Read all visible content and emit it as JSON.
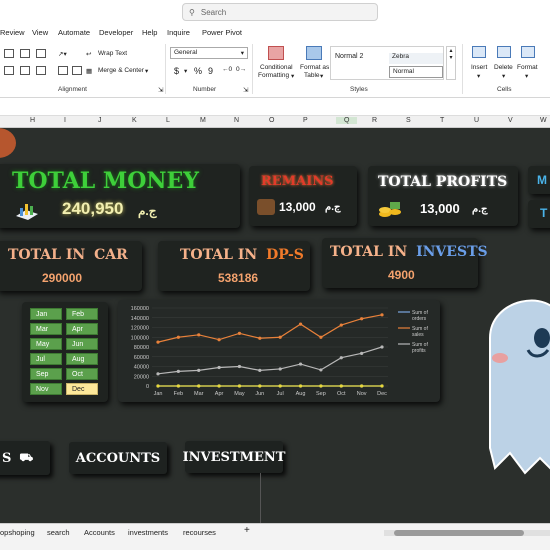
{
  "search": {
    "placeholder": "Search"
  },
  "ribbon_tabs": [
    "Review",
    "View",
    "Automate",
    "Developer",
    "Help",
    "Inquire",
    "Power Pivot"
  ],
  "ribbon": {
    "wrap_text": "Wrap Text",
    "merge_center": "Merge & Center",
    "alignment_label": "Alignment",
    "number_format": "General",
    "currency": "$",
    "percent": "%",
    "comma": "9",
    "number_label": "Number",
    "conditional": "Conditional",
    "formatting": "Formatting",
    "format_as": "Format as",
    "table": "Table",
    "style_normal2": "Normal 2",
    "style_zebra": "Zebra",
    "style_normal": "Normal",
    "styles_label": "Styles",
    "insert": "Insert",
    "delete": "Delete",
    "format": "Format",
    "cells_label": "Cells"
  },
  "columns": [
    "H",
    "I",
    "J",
    "K",
    "L",
    "M",
    "N",
    "O",
    "P",
    "Q",
    "R",
    "S",
    "T",
    "U",
    "V",
    "W"
  ],
  "dashboard": {
    "total_money_title": "TOTAL MONEY",
    "total_money_value": "240,950",
    "currency": "ج.م",
    "remains_title": "REMAINS",
    "remains_value": "13,000",
    "total_profits_title": "TOTAL PROFITS",
    "total_profits_value": "13,000",
    "total_car_title_a": "TOTAL IN",
    "total_car_title_b": "CAR",
    "total_car_value": "290000",
    "total_dps_title_a": "TOTAL IN",
    "total_dps_title_b": "DP-S",
    "total_dps_value": "538186",
    "total_invests_title_a": "TOTAL IN",
    "total_invests_title_b": "INVESTS",
    "total_invests_value": "4900",
    "right_edge_label_1": "M",
    "right_edge_label_2": "T",
    "months": [
      "Jan",
      "Feb",
      "Mar",
      "Apr",
      "May",
      "Jun",
      "Jul",
      "Aug",
      "Sep",
      "Oct",
      "Nov",
      "Dec"
    ],
    "selected_month": "Dec",
    "btn_s": "S",
    "btn_accounts": "ACCOUNTS",
    "btn_investment": "INVESTMENT"
  },
  "chart_data": {
    "type": "line",
    "categories": [
      "Jan",
      "Feb",
      "Mar",
      "Apr",
      "May",
      "Jun",
      "Jul",
      "Aug",
      "Sep",
      "Oct",
      "Nov",
      "Dec"
    ],
    "ylim": [
      0,
      160000
    ],
    "yticks": [
      "0",
      "20000",
      "40000",
      "60000",
      "80000",
      "100000",
      "120000",
      "140000",
      "160000"
    ],
    "series": [
      {
        "name": "Sum of orders",
        "color": "#7aa6e0",
        "values": [
          0,
          0,
          0,
          0,
          0,
          0,
          0,
          0,
          0,
          0,
          0,
          0
        ]
      },
      {
        "name": "Sum of sales",
        "color": "#e8813a",
        "values": [
          90000,
          100000,
          105000,
          95000,
          108000,
          98000,
          100000,
          127000,
          100000,
          125000,
          138000,
          146000
        ]
      },
      {
        "name": "Sum of profits",
        "color": "#b8b8b8",
        "values": [
          25000,
          30000,
          32000,
          38000,
          40000,
          32000,
          35000,
          45000,
          33000,
          58000,
          67000,
          80000
        ]
      },
      {
        "name": "",
        "color": "#e8d83a",
        "values": [
          0,
          0,
          0,
          0,
          0,
          0,
          0,
          0,
          0,
          0,
          0,
          0
        ]
      }
    ],
    "legend": "right"
  },
  "sheet_tabs": [
    "opshoping",
    "search",
    "Accounts",
    "investments",
    "recourses"
  ],
  "add_sheet": "+"
}
